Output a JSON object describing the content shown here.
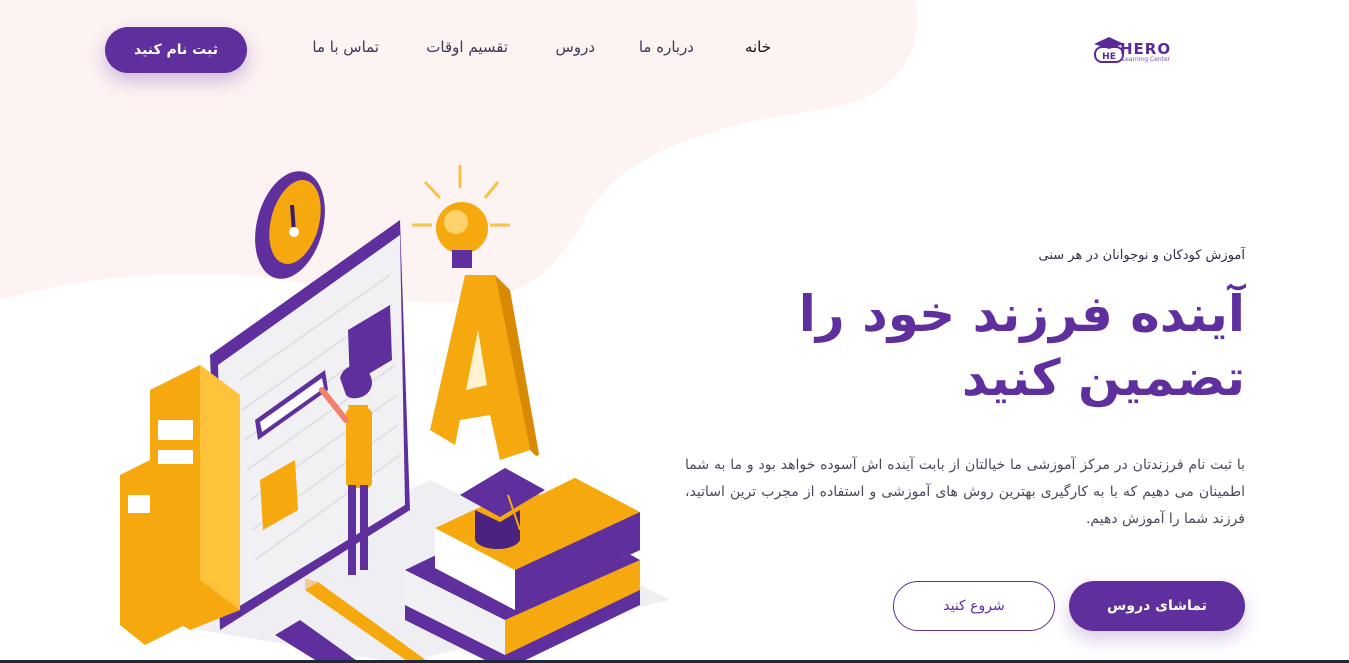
{
  "brand": {
    "name": "HERO",
    "tagline": "Learning Center",
    "primary_color": "#5f2f9e",
    "accent_color": "#f6a90f",
    "blob_color": "#fdf3f2"
  },
  "nav": {
    "items": [
      {
        "label": "خانه"
      },
      {
        "label": "درباره ما"
      },
      {
        "label": "دروس"
      },
      {
        "label": "تقسیم اوقات"
      },
      {
        "label": "تماس با ما"
      }
    ],
    "signup_label": "ثبت نام کنید"
  },
  "hero": {
    "subtitle": "آموزش کودکان و نوجوانان در هر سنی",
    "title_line1": "آینده فرزند خود را",
    "title_line2": "تضمین کنید",
    "description": "با ثبت نام فرزندتان در مرکز آموزشی ما خیالتان از بابت آینده اش آسوده خواهد بود و ما به شما اطمینان می دهیم که با به کارگیری بهترین روش های آموزشی و استفاده از مجرب ترین اساتید، فرزند شما را آموزش دهیم.",
    "primary_button": "تماشای دروس",
    "secondary_button": "شروع کنید"
  },
  "illustration": {
    "icons": [
      "clock-icon",
      "lightbulb-icon",
      "letter-a-icon",
      "books-icon",
      "graduation-cap-icon",
      "pencil-icon"
    ]
  }
}
